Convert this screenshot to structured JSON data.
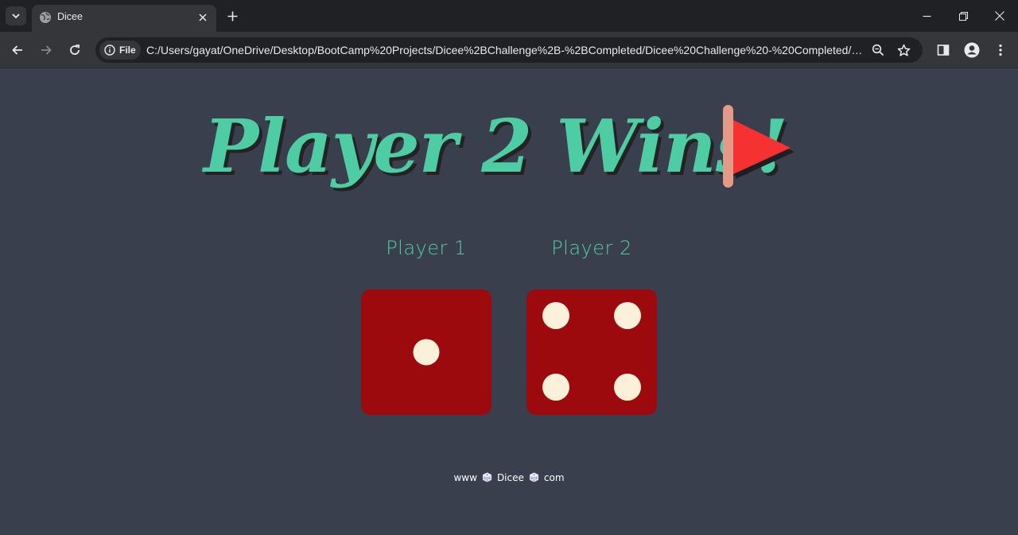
{
  "browser": {
    "tab_title": "Dicee",
    "security_chip": "File",
    "url": "C:/Users/gayat/OneDrive/Desktop/BootCamp%20Projects/Dicee%2BChallenge%2B-%2BCompleted/Dicee%20Challenge%20-%20Completed/dic..."
  },
  "page": {
    "headline": "Player 2 Wins!",
    "players": [
      {
        "label": "Player 1",
        "die_value": 1
      },
      {
        "label": "Player 2",
        "die_value": 4
      }
    ],
    "footer": {
      "prefix": "www",
      "brand": "Dicee",
      "suffix": "com"
    }
  },
  "colors": {
    "background": "#393f4d",
    "accent": "#4ecca3",
    "die": "#9c0a0e",
    "pip": "#fbf0d9",
    "flag": "#f53131"
  }
}
